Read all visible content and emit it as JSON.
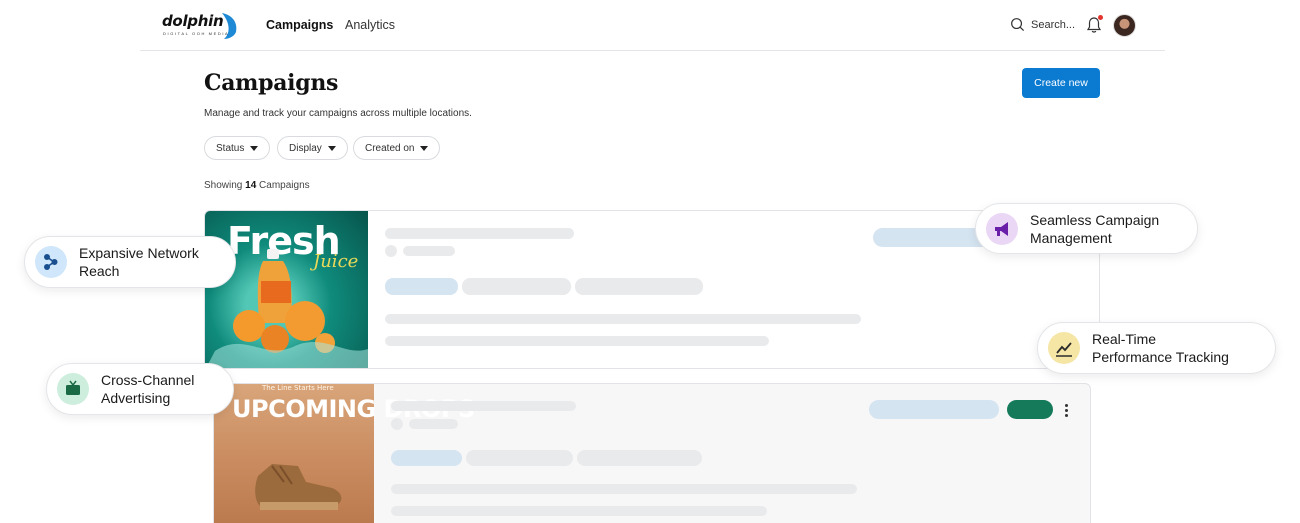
{
  "brand": {
    "name": "dolphin",
    "tagline": "DIGITAL OOH MEDIA",
    "accent": "#0b7ad1"
  },
  "nav": {
    "items": [
      {
        "label": "Campaigns",
        "active": true
      },
      {
        "label": "Analytics",
        "active": false
      }
    ]
  },
  "header": {
    "search_placeholder": "Search...",
    "has_notification": true
  },
  "page": {
    "title": "Campaigns",
    "subtitle": "Manage and track your campaigns across multiple locations.",
    "create_label": "Create new",
    "filters": [
      {
        "label": "Status"
      },
      {
        "label": "Display"
      },
      {
        "label": "Created on"
      }
    ],
    "showing_prefix": "Showing",
    "campaign_count": "14",
    "showing_suffix": "Campaigns"
  },
  "campaigns": [
    {
      "image_text": "Fresh",
      "image_subtext": "Juice"
    },
    {
      "image_tagline": "The Line Starts Here",
      "image_text": "UPCOMING DROPS"
    }
  ],
  "features": [
    {
      "label": "Expansive Network Reach",
      "icon": "network-icon",
      "color": "#2b7fd8"
    },
    {
      "label": "Seamless Campaign Management",
      "icon": "megaphone-icon",
      "color": "#7b2fbf"
    },
    {
      "label": "Real-Time Performance Tracking",
      "icon": "chart-line-icon",
      "color": "#c9a21a"
    },
    {
      "label": "Cross-Channel Advertising",
      "icon": "tv-icon",
      "color": "#1f8f5a"
    }
  ]
}
